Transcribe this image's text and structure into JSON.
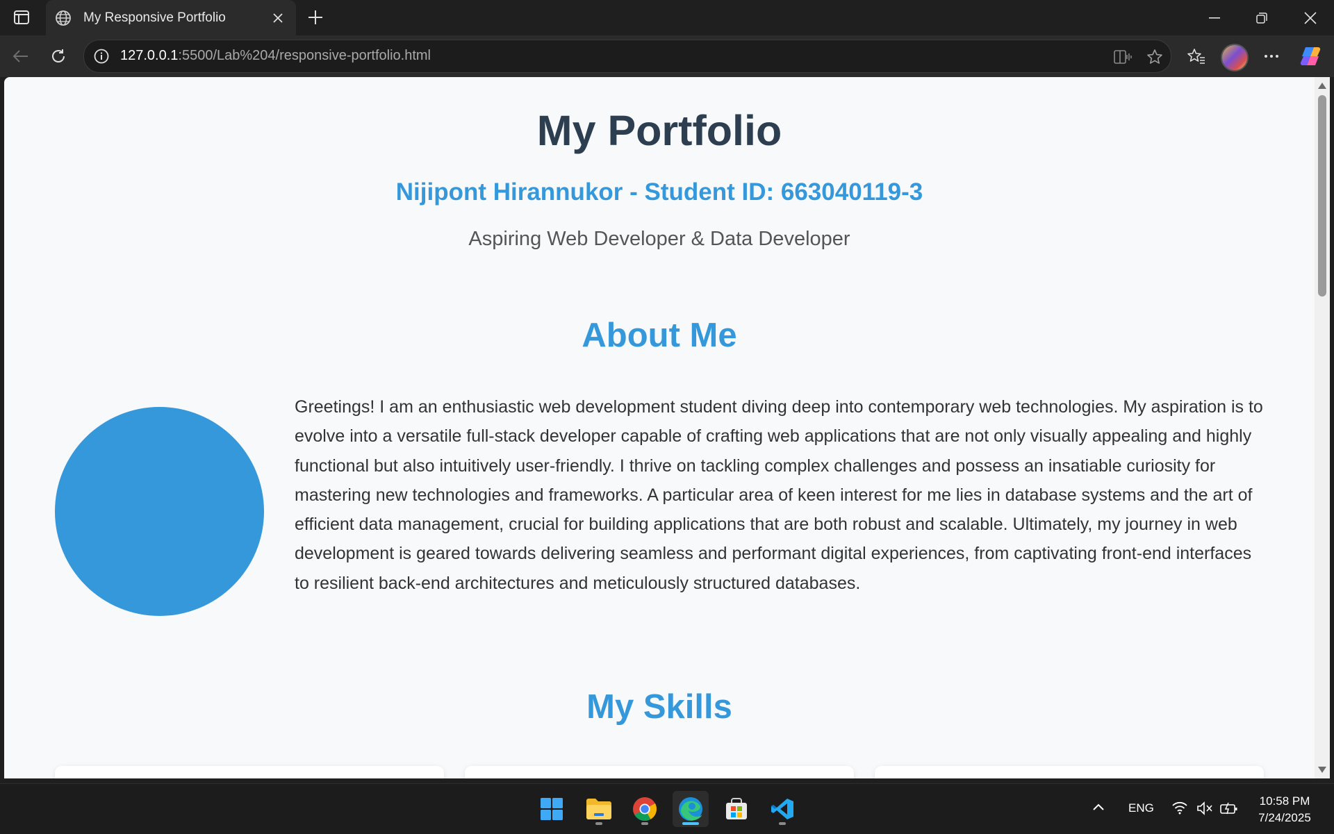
{
  "browser": {
    "tab_title": "My Responsive Portfolio",
    "url_host": "127.0.0.1",
    "url_rest": ":5500/Lab%204/responsive-portfolio.html"
  },
  "page": {
    "title": "My Portfolio",
    "subtitle": "Nijipont Hirannukor - Student ID: 663040119-3",
    "tagline": "Aspiring Web Developer & Data Developer",
    "about": {
      "heading": "About Me",
      "text": "Greetings! I am an enthusiastic web development student diving deep into contemporary web technologies. My aspiration is to evolve into a versatile full-stack developer capable of crafting web applications that are not only visually appealing and highly functional but also intuitively user-friendly. I thrive on tackling complex challenges and possess an insatiable curiosity for mastering new technologies and frameworks. A particular area of keen interest for me lies in database systems and the art of efficient data management, crucial for building applications that are both robust and scalable. Ultimately, my journey in web development is geared towards delivering seamless and performant digital experiences, from captivating front-end interfaces to resilient back-end architectures and meticulously structured databases."
    },
    "skills": {
      "heading": "My Skills"
    }
  },
  "taskbar": {
    "apps": [
      "start-icon",
      "file-explorer-icon",
      "chrome-icon",
      "edge-icon",
      "store-icon",
      "vscode-icon"
    ],
    "language": "ENG",
    "time": "10:58 PM",
    "date": "7/24/2025"
  },
  "colors": {
    "accent": "#3498db",
    "heading": "#2c3e50",
    "page_bg": "#f7f9fb"
  }
}
